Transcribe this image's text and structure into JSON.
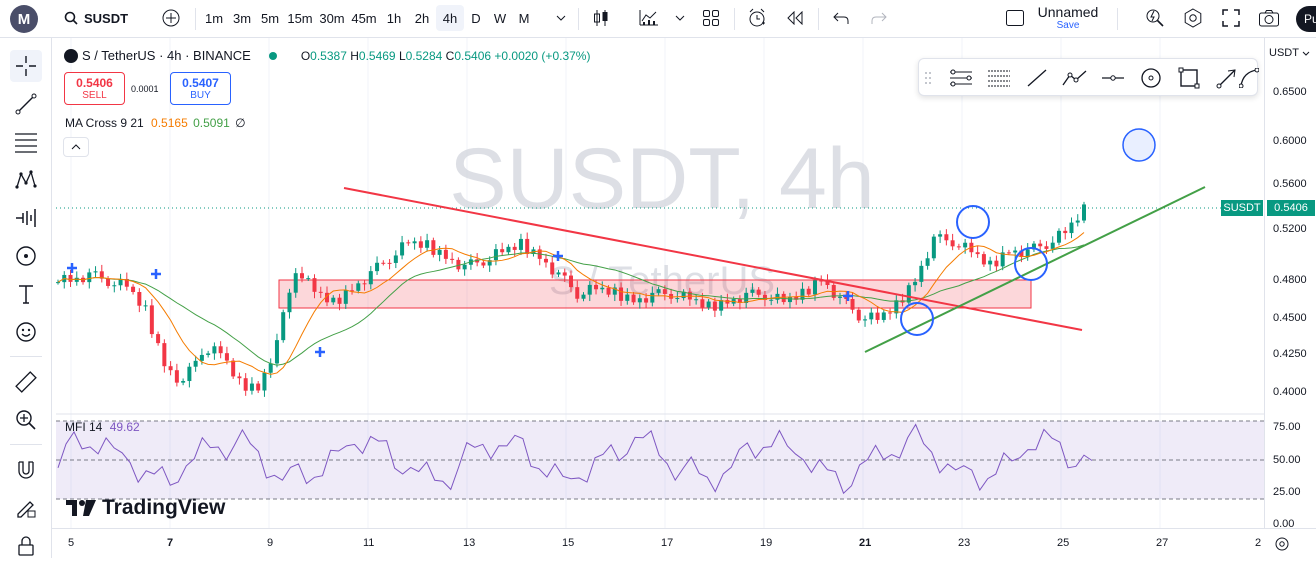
{
  "header": {
    "logo_letter": "M",
    "symbol": "SUSDT",
    "timeframes": [
      "1m",
      "3m",
      "5m",
      "15m",
      "30m",
      "45m",
      "1h",
      "2h",
      "4h",
      "D",
      "W",
      "M"
    ],
    "active_timeframe": "4h",
    "layout_name": "Unnamed",
    "save_label": "Save",
    "publish_label": "Pu"
  },
  "legend": {
    "title": "S / TetherUS · 4h · BINANCE",
    "o_label": "O",
    "o": "0.5387",
    "h_label": "H",
    "h": "0.5469",
    "l_label": "L",
    "l": "0.5284",
    "c_label": "C",
    "c": "0.5406",
    "change": "+0.0020 (+0.37%)"
  },
  "trade": {
    "sell_price": "0.5406",
    "sell_label": "SELL",
    "spread": "0.0001",
    "buy_price": "0.5407",
    "buy_label": "BUY"
  },
  "indicators": {
    "ma_label": "MA Cross 9 21",
    "ma_fast": "0.5165",
    "ma_slow": "0.5091",
    "ma_icon": "∅",
    "mfi_label": "MFI 14",
    "mfi_value": "49.62"
  },
  "watermark": {
    "main": "SUSDT, 4h",
    "sub": "S / TetherUS"
  },
  "price_axis": {
    "currency": "USDT",
    "labels": [
      "0.6500",
      "0.6000",
      "0.5600",
      "0.5200",
      "0.4800",
      "0.4500",
      "0.4250",
      "0.4000"
    ],
    "last_tag_symbol": "SUSDT",
    "last_tag_price": "0.5406"
  },
  "mfi_axis": {
    "labels": [
      "75.00",
      "50.00",
      "25.00",
      "0.00"
    ]
  },
  "time_axis": {
    "labels": [
      "5",
      "7",
      "9",
      "11",
      "13",
      "15",
      "17",
      "19",
      "21",
      "23",
      "25",
      "27",
      "2"
    ]
  },
  "branding": {
    "name": "TradingView"
  },
  "colors": {
    "up": "#089981",
    "down": "#f23645",
    "ma_fast": "#f57c00",
    "ma_slow": "#43a047",
    "accent": "#2962ff",
    "mfi": "#7e57c2"
  },
  "chart_data": {
    "type": "candlestick",
    "x_ticks": [
      "5",
      "7",
      "9",
      "11",
      "13",
      "15",
      "17",
      "19",
      "21",
      "23",
      "25"
    ],
    "close_series_approx": [
      0.487,
      0.49,
      0.486,
      0.481,
      0.462,
      0.421,
      0.405,
      0.432,
      0.429,
      0.405,
      0.402,
      0.437,
      0.496,
      0.477,
      0.468,
      0.48,
      0.491,
      0.504,
      0.515,
      0.513,
      0.505,
      0.496,
      0.502,
      0.508,
      0.514,
      0.505,
      0.49,
      0.476,
      0.479,
      0.476,
      0.471,
      0.474,
      0.476,
      0.471,
      0.465,
      0.47,
      0.474,
      0.475,
      0.469,
      0.475,
      0.488,
      0.471,
      0.459,
      0.455,
      0.466,
      0.487,
      0.518,
      0.517,
      0.508,
      0.497,
      0.51,
      0.508,
      0.515,
      0.523,
      0.541
    ],
    "ylim": [
      0.39,
      0.66
    ],
    "annotations": {
      "rectangle_range": [
        0.458,
        0.482
      ],
      "trendline_down": true,
      "trendline_up": true
    }
  },
  "mfi_data": {
    "type": "line",
    "range": [
      0,
      100
    ],
    "bands": [
      20,
      80
    ],
    "last": 49.62
  }
}
